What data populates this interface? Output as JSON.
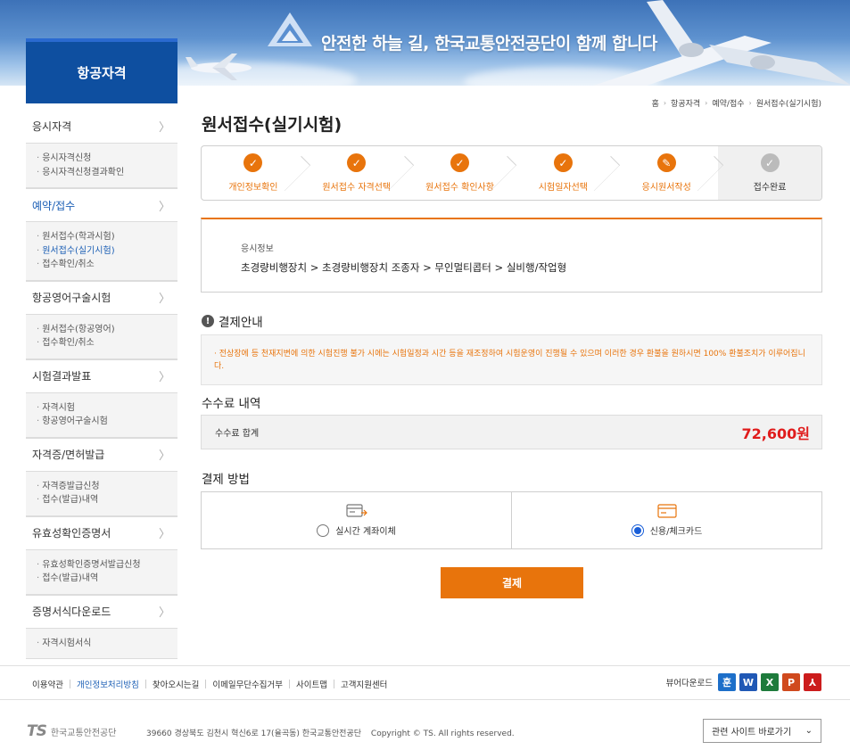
{
  "banner": {
    "slogan": "안전한 하늘 길, 한국교통안전공단이 함께 합니다"
  },
  "sidebar": {
    "title": "항공자격",
    "groups": [
      {
        "label": "응시자격",
        "sub": [
          "응시자격신청",
          "응시자격신청결과확인"
        ]
      },
      {
        "label": "예약/접수",
        "sub": [
          "원서접수(학과시험)",
          "원서접수(실기시험)",
          "접수확인/취소"
        ]
      },
      {
        "label": "항공영어구술시험",
        "sub": [
          "원서접수(항공영어)",
          "접수확인/취소"
        ]
      },
      {
        "label": "시험결과발표",
        "sub": [
          "자격시험",
          "항공영어구술시험"
        ]
      },
      {
        "label": "자격증/면허발급",
        "sub": [
          "자격증발급신청",
          "접수(발급)내역"
        ]
      },
      {
        "label": "유효성확인증명서",
        "sub": [
          "유효성확인증명서발급신청",
          "접수(발급)내역"
        ]
      },
      {
        "label": "증명서식다운로드",
        "sub": [
          "자격시험서식"
        ]
      }
    ]
  },
  "breadcrumb": [
    "홈",
    "항공자격",
    "예약/접수",
    "원서접수(실기시험)"
  ],
  "page_title": "원서접수(실기시험)",
  "steps": [
    {
      "label": "개인정보확인",
      "state": "done"
    },
    {
      "label": "원서접수 자격선택",
      "state": "done"
    },
    {
      "label": "원서접수 확인사항",
      "state": "done"
    },
    {
      "label": "시험일자선택",
      "state": "done"
    },
    {
      "label": "응시원서작성",
      "state": "edit"
    },
    {
      "label": "접수완료",
      "state": "pending"
    }
  ],
  "exam_info": {
    "label": "응시정보",
    "value": "초경량비행장치 > 초경량비행장치 조종자 > 무인멀티콥터 > 실비행/작업형"
  },
  "payment_notice": {
    "heading": "결제안내",
    "text": "· 전상장에 등 천재지변에 의한 시험진행 불가 시에는 시험일정과 시간 등을 재조정하여 시험운영이 진행될 수 있으며 이러한 경우 환불을 원하시면 100% 환불조치가 이루어집니다."
  },
  "fee": {
    "heading": "수수료 내역",
    "label": "수수료 합계",
    "amount": "72,600원"
  },
  "payment_method": {
    "heading": "결제 방법",
    "options": [
      {
        "label": "실시간 계좌이체",
        "selected": false
      },
      {
        "label": "신용/체크카드",
        "selected": true
      }
    ]
  },
  "pay_button": "결제",
  "footer": {
    "links": [
      "이용약관",
      "개인정보처리방침",
      "찾아오시는길",
      "이메일무단수집거부",
      "사이트맵",
      "고객지원센터"
    ],
    "viewer_label": "뷰어다운로드",
    "viewers": [
      {
        "glyph": "훈",
        "color": "#1d6fc9"
      },
      {
        "glyph": "W",
        "color": "#2058b5"
      },
      {
        "glyph": "X",
        "color": "#1e7b3c"
      },
      {
        "glyph": "P",
        "color": "#d04a1e"
      },
      {
        "glyph": "⅄",
        "color": "#cc1c1c"
      }
    ],
    "logo_ts": "TS",
    "logo_name": "한국교통안전공단",
    "address": "39660 경상북도 김천시 혁신6로 17(율곡동) 한국교통안전공단",
    "copyright": "Copyright © TS. All rights reserved.",
    "related_sites": "관련 사이트 바로가기"
  },
  "colors": {
    "accent": "#e8740c",
    "brand": "#0e4fa0",
    "fee": "#e01c1c"
  }
}
